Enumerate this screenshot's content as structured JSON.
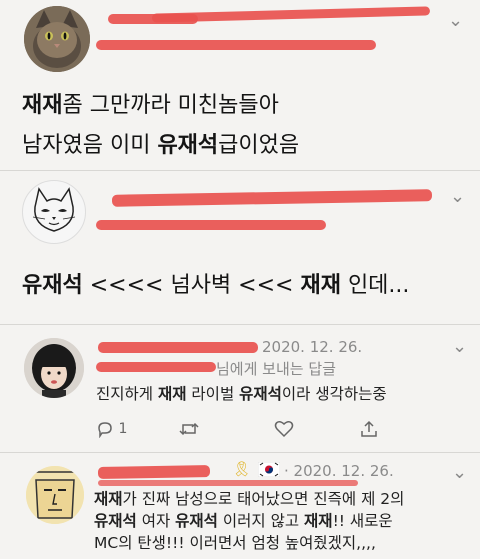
{
  "tweet1": {
    "line1": {
      "bold": "재재",
      "rest": "좀 그만까라 미친놈들아"
    },
    "line2": {
      "pre": "남자였음 이미 ",
      "bold": "유재석",
      "post": "급이었음"
    }
  },
  "tweet2": {
    "text": {
      "b1": "유재석",
      "m1": " <<<< 넘사벽 <<< ",
      "b2": "재재",
      "post": " 인데..."
    }
  },
  "reply1": {
    "date": "2020. 12. 26.",
    "replying_to": "님에게 보내는 답글",
    "text": {
      "pre": "진지하게 ",
      "b1": "재재",
      "m1": " 라이벌 ",
      "b2": "유재석",
      "post": "이라 생각하는중"
    },
    "actions": {
      "reply_count": "1"
    }
  },
  "reply2": {
    "date": "2020. 12. 26.",
    "line1": {
      "b1": "재재",
      "rest": "가 진짜 남성으로 태어났으면 진즉에 제 2의"
    },
    "line2": {
      "b1": "유재석",
      "m1": " 여자 ",
      "b2": "유재석",
      "m2": " 이러지 않고 ",
      "b3": "재재",
      "post": "!! 새로운"
    },
    "line3": "MC의 탄생!!! 이러면서 엄청 높여줬겠지,,,,"
  },
  "icons": [
    "cat-avatar-icon",
    "cat-sketch-avatar-icon",
    "girl-avatar-icon",
    "face-avatar-icon",
    "chevron-down-icon",
    "reply-icon",
    "retweet-icon",
    "like-icon",
    "share-icon",
    "ribbon-icon",
    "korea-flag-icon"
  ],
  "colors": {
    "redaction": "#e8524f",
    "background": "#f4f3f1",
    "meta": "#8a8a8a"
  }
}
